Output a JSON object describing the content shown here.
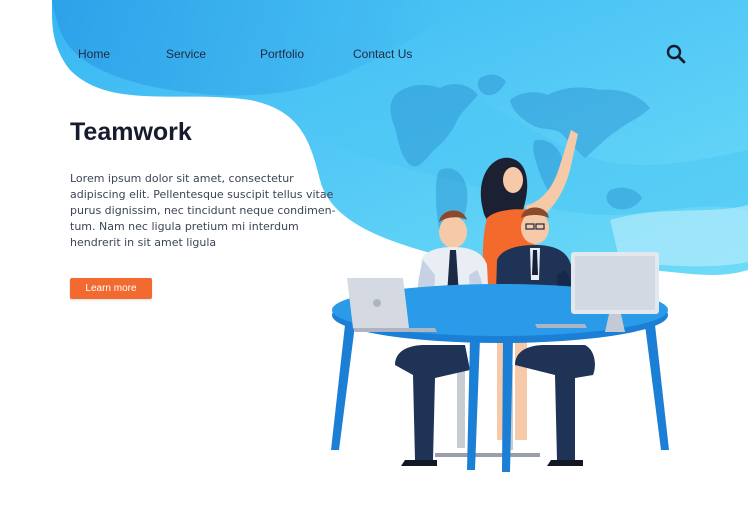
{
  "nav": {
    "items": [
      {
        "label": "Home"
      },
      {
        "label": "Service"
      },
      {
        "label": "Portfolio"
      },
      {
        "label": "Contact Us"
      }
    ],
    "search_icon": "search-icon"
  },
  "hero": {
    "title": "Teamwork",
    "body_lines": [
      "Lorem ipsum dolor sit amet, consectetur",
      "adipiscing elit. Pellentesque suscipit tellus vitae",
      "purus dignissim, nec tincidunt neque condimen-",
      "tum. Nam nec ligula pretium mi interdum",
      "hendrerit in sit amet ligula"
    ],
    "cta_label": "Learn more"
  },
  "colors": {
    "accent": "#f26a30",
    "wave_light": "#5fd3f6",
    "wave_dark": "#2a9be6",
    "table": "#2288e0",
    "text_dark": "#161c2d"
  }
}
